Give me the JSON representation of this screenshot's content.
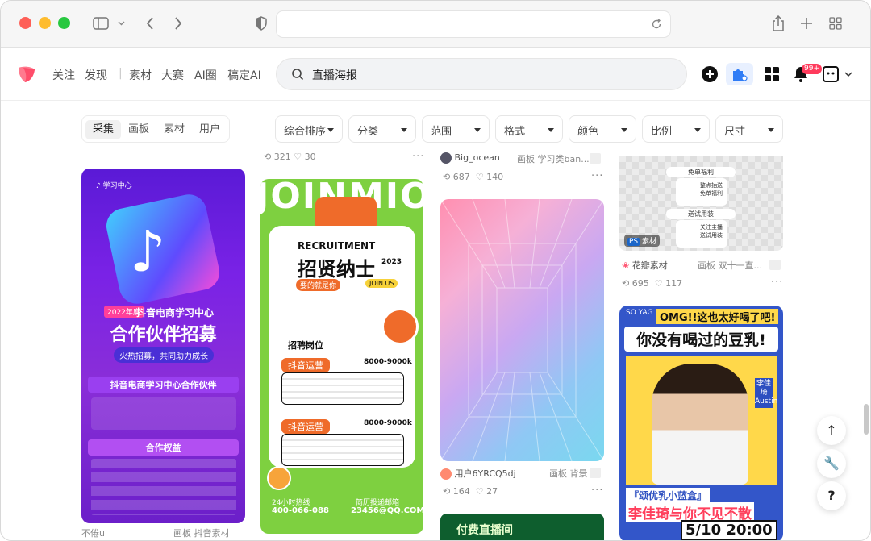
{
  "site_nav": [
    "关注",
    "发现",
    "素材",
    "大赛",
    "AI圈",
    "稿定AI"
  ],
  "search": {
    "value": "直播海报"
  },
  "notification_badge": "99+",
  "tabs": [
    "采集",
    "画板",
    "素材",
    "用户"
  ],
  "active_tab": "采集",
  "filters": [
    "综合排序",
    "分类",
    "范围",
    "格式",
    "颜色",
    "比例",
    "尺寸"
  ],
  "cards": {
    "col1": {
      "top_stats": {
        "saves": "321",
        "likes": "30"
      },
      "tag_year": "2022年度",
      "title_line1": "抖音电商学习中心",
      "title_line2": "合作伙伴招募",
      "slogan": "火热招募，共同助力成长",
      "section1": "抖音电商学习中心合作伙伴",
      "section2": "合作权益",
      "bottom_user": "不倦u",
      "bottom_board": "画板 抖音素材"
    },
    "col2": {
      "hero": "JOINMIO",
      "recruit": "RECRUITMENT",
      "title": "招贤纳士",
      "year": "2023",
      "slogan": "要的就是你",
      "join": "JOIN US",
      "jobs_label": "招聘岗位",
      "job1": "抖音运营",
      "salary1": "8000-9000k",
      "job2": "抖音运营",
      "salary2": "8000-9000k",
      "hotline_label": "24小时热线",
      "hotline": "400-066-088",
      "email_label": "简历投递邮箱",
      "email": "23456@QQ.COM"
    },
    "col3": {
      "top_user": "Big_ocean",
      "top_board": "画板 学习类ban...",
      "top_stats": {
        "saves": "687",
        "likes": "140"
      },
      "user": "用户6YRCQ5dj",
      "board": "画板 背景",
      "stats": {
        "saves": "164",
        "likes": "27"
      },
      "bottom_card_text": "付费直播间"
    },
    "col4": {
      "mini1": "免单福利",
      "mini2": "整点抽送 免单福利",
      "mini3": "送试用装",
      "mini4": "关注主播 送试用装",
      "ps_tag": "素材",
      "user": "花瓣素材",
      "board": "画板 双十一直...",
      "stats": {
        "saves": "695",
        "likes": "117"
      },
      "ad_brand": "SO YAG",
      "ad_line1": "OMG!!这也太好喝了吧!",
      "ad_line2": "你没有喝过的豆乳!",
      "ad_name_tag": "李佳琦Austin",
      "ad_product": "『颂优乳小蓝盒』",
      "ad_bottom": "李佳琦与你不见不散",
      "ad_date": "5/10 20:00"
    }
  },
  "colors": {
    "accent": "#ff5a76",
    "search_bg": "#f2f3f5",
    "chrome_bg": "#f6f6f6"
  }
}
